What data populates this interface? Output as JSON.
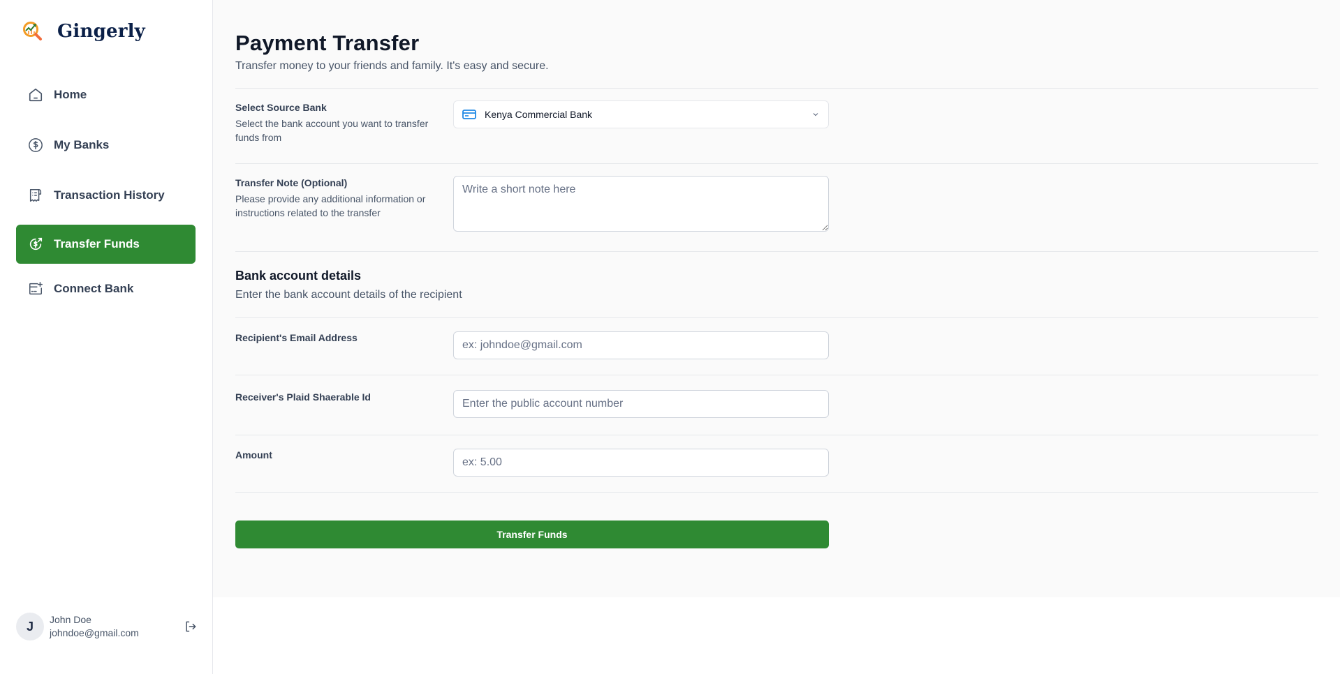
{
  "brand": {
    "name": "Gingerly",
    "logo_icon": "chart-magnifier-logo"
  },
  "sidebar": {
    "items": [
      {
        "label": "Home",
        "icon": "home-icon",
        "active": false
      },
      {
        "label": "My Banks",
        "icon": "dollar-circle-icon",
        "active": false
      },
      {
        "label": "Transaction History",
        "icon": "receipt-icon",
        "active": false
      },
      {
        "label": "Transfer Funds",
        "icon": "money-send-icon",
        "active": true
      },
      {
        "label": "Connect Bank",
        "icon": "card-add-icon",
        "active": false
      }
    ],
    "user": {
      "initial": "J",
      "name": "John Doe",
      "email": "johndoe@gmail.com",
      "logout_icon": "logout-icon"
    }
  },
  "page": {
    "title": "Payment Transfer",
    "subtitle": "Transfer money to your friends and family. It's easy and secure."
  },
  "form": {
    "source_bank": {
      "label": "Select Source Bank",
      "description": "Select the bank account you want to transfer funds from",
      "selected": "Kenya Commercial Bank"
    },
    "note": {
      "label": "Transfer Note (Optional)",
      "description": "Please provide any additional information or instructions related to the transfer",
      "placeholder": "Write a short note here",
      "value": ""
    },
    "bank_details": {
      "title": "Bank account details",
      "subtitle": "Enter the bank account details of the recipient"
    },
    "email": {
      "label": "Recipient's Email Address",
      "placeholder": "ex: johndoe@gmail.com",
      "value": ""
    },
    "sharable_id": {
      "label": "Receiver's Plaid Shaerable Id",
      "placeholder": "Enter the public account number",
      "value": ""
    },
    "amount": {
      "label": "Amount",
      "placeholder": "ex: 5.00",
      "value": ""
    },
    "submit_label": "Transfer Funds"
  },
  "colors": {
    "accent": "#2f8a33",
    "brand_text": "#0b2048",
    "card_icon": "#1e88e5"
  }
}
